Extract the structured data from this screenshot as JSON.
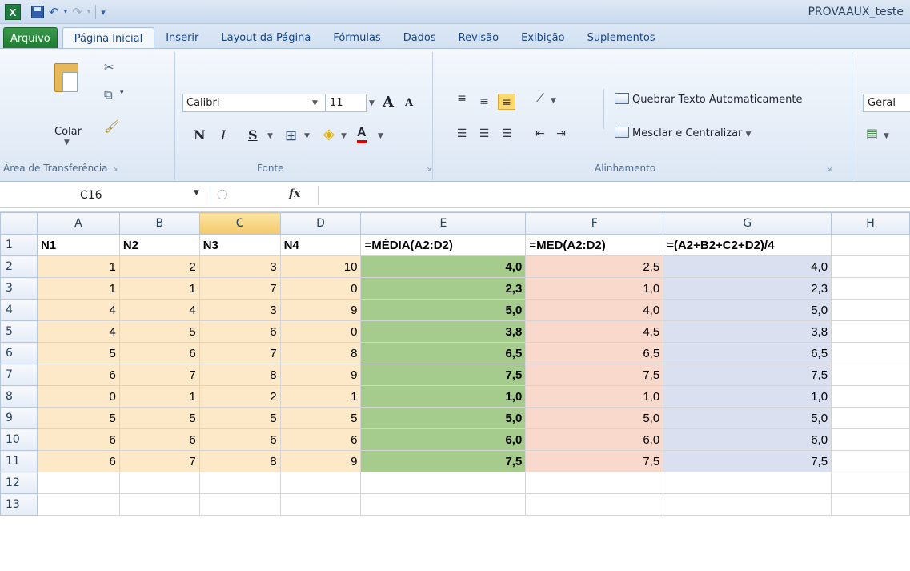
{
  "title_bar": {
    "window_title": "PROVAAUX_teste",
    "app_icon": "X"
  },
  "quick_access": {
    "icons": [
      "excel-icon",
      "save-icon",
      "undo-icon",
      "redo-icon",
      "customize-icon"
    ]
  },
  "tabs": [
    "Arquivo",
    "Página Inicial",
    "Inserir",
    "Layout da Página",
    "Fórmulas",
    "Dados",
    "Revisão",
    "Exibição",
    "Suplementos"
  ],
  "active_tab": "Página Inicial",
  "ribbon": {
    "clipboard": {
      "paste_label": "Colar",
      "group_label": "Área de Transferência"
    },
    "font": {
      "font_name": "Calibri",
      "font_size": "11",
      "bold": "N",
      "italic": "I",
      "underline": "S",
      "grow_font": "A",
      "shrink_font": "A",
      "font_color_letter": "A",
      "group_label": "Fonte"
    },
    "alignment": {
      "wrap_text": "Quebrar Texto Automaticamente",
      "merge_center": "Mesclar e Centralizar",
      "group_label": "Alinhamento"
    },
    "number": {
      "format": "Geral"
    }
  },
  "formula_bar": {
    "name_box": "C16",
    "fx_label": "fx",
    "formula": ""
  },
  "sheet": {
    "columns": [
      "A",
      "B",
      "C",
      "D",
      "E",
      "F",
      "G",
      "H"
    ],
    "selected_column": "C",
    "rows": [
      {
        "n": "1",
        "cells": [
          "N1",
          "N2",
          "N3",
          "N4",
          "=MÉDIA(A2:D2)",
          "=MED(A2:D2)",
          "=(A2+B2+C2+D2)/4",
          ""
        ]
      },
      {
        "n": "2",
        "cells": [
          "1",
          "2",
          "3",
          "10",
          "4,0",
          "2,5",
          "4,0",
          ""
        ]
      },
      {
        "n": "3",
        "cells": [
          "1",
          "1",
          "7",
          "0",
          "2,3",
          "1,0",
          "2,3",
          ""
        ]
      },
      {
        "n": "4",
        "cells": [
          "4",
          "4",
          "3",
          "9",
          "5,0",
          "4,0",
          "5,0",
          ""
        ]
      },
      {
        "n": "5",
        "cells": [
          "4",
          "5",
          "6",
          "0",
          "3,8",
          "4,5",
          "3,8",
          ""
        ]
      },
      {
        "n": "6",
        "cells": [
          "5",
          "6",
          "7",
          "8",
          "6,5",
          "6,5",
          "6,5",
          ""
        ]
      },
      {
        "n": "7",
        "cells": [
          "6",
          "7",
          "8",
          "9",
          "7,5",
          "7,5",
          "7,5",
          ""
        ]
      },
      {
        "n": "8",
        "cells": [
          "0",
          "1",
          "2",
          "1",
          "1,0",
          "1,0",
          "1,0",
          ""
        ]
      },
      {
        "n": "9",
        "cells": [
          "5",
          "5",
          "5",
          "5",
          "5,0",
          "5,0",
          "5,0",
          ""
        ]
      },
      {
        "n": "10",
        "cells": [
          "6",
          "6",
          "6",
          "6",
          "6,0",
          "6,0",
          "6,0",
          ""
        ]
      },
      {
        "n": "11",
        "cells": [
          "6",
          "7",
          "8",
          "9",
          "7,5",
          "7,5",
          "7,5",
          ""
        ]
      },
      {
        "n": "12",
        "cells": [
          "",
          "",
          "",
          "",
          "",
          "",
          "",
          ""
        ]
      },
      {
        "n": "13",
        "cells": [
          "",
          "",
          "",
          "",
          "",
          "",
          "",
          ""
        ]
      }
    ]
  },
  "colors": {
    "input_fill": "#fde9c8",
    "mean_fill": "#a6cc8d",
    "median_fill": "#f8d9cb",
    "formula_fill": "#dbe0f1",
    "file_tab": "#1e7a30"
  }
}
